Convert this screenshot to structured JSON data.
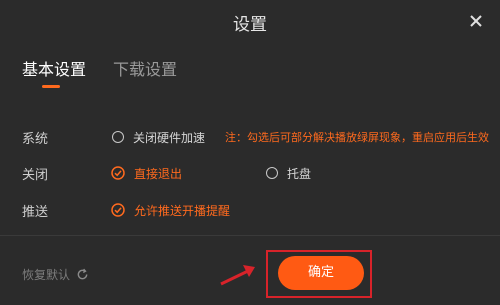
{
  "window": {
    "title": "设置",
    "close_icon": "close-icon"
  },
  "tabs": [
    {
      "label": "基本设置",
      "active": true
    },
    {
      "label": "下载设置",
      "active": false
    }
  ],
  "settings": {
    "system": {
      "label": "系统",
      "option_label": "关闭硬件加速",
      "checked": false,
      "note": "注：勾选后可部分解决播放绿屏现象，重启应用后生效"
    },
    "close": {
      "label": "关闭",
      "options": [
        {
          "label": "直接退出",
          "selected": true
        },
        {
          "label": "托盘",
          "selected": false
        }
      ]
    },
    "push": {
      "label": "推送",
      "option_label": "允许推送开播提醒",
      "checked": true
    }
  },
  "footer": {
    "restore_label": "恢复默认",
    "restore_icon": "refresh-icon",
    "confirm_label": "确定"
  },
  "colors": {
    "accent": "#ff6a1e",
    "background": "#2b2b2b",
    "highlight_box": "#d8232a"
  }
}
